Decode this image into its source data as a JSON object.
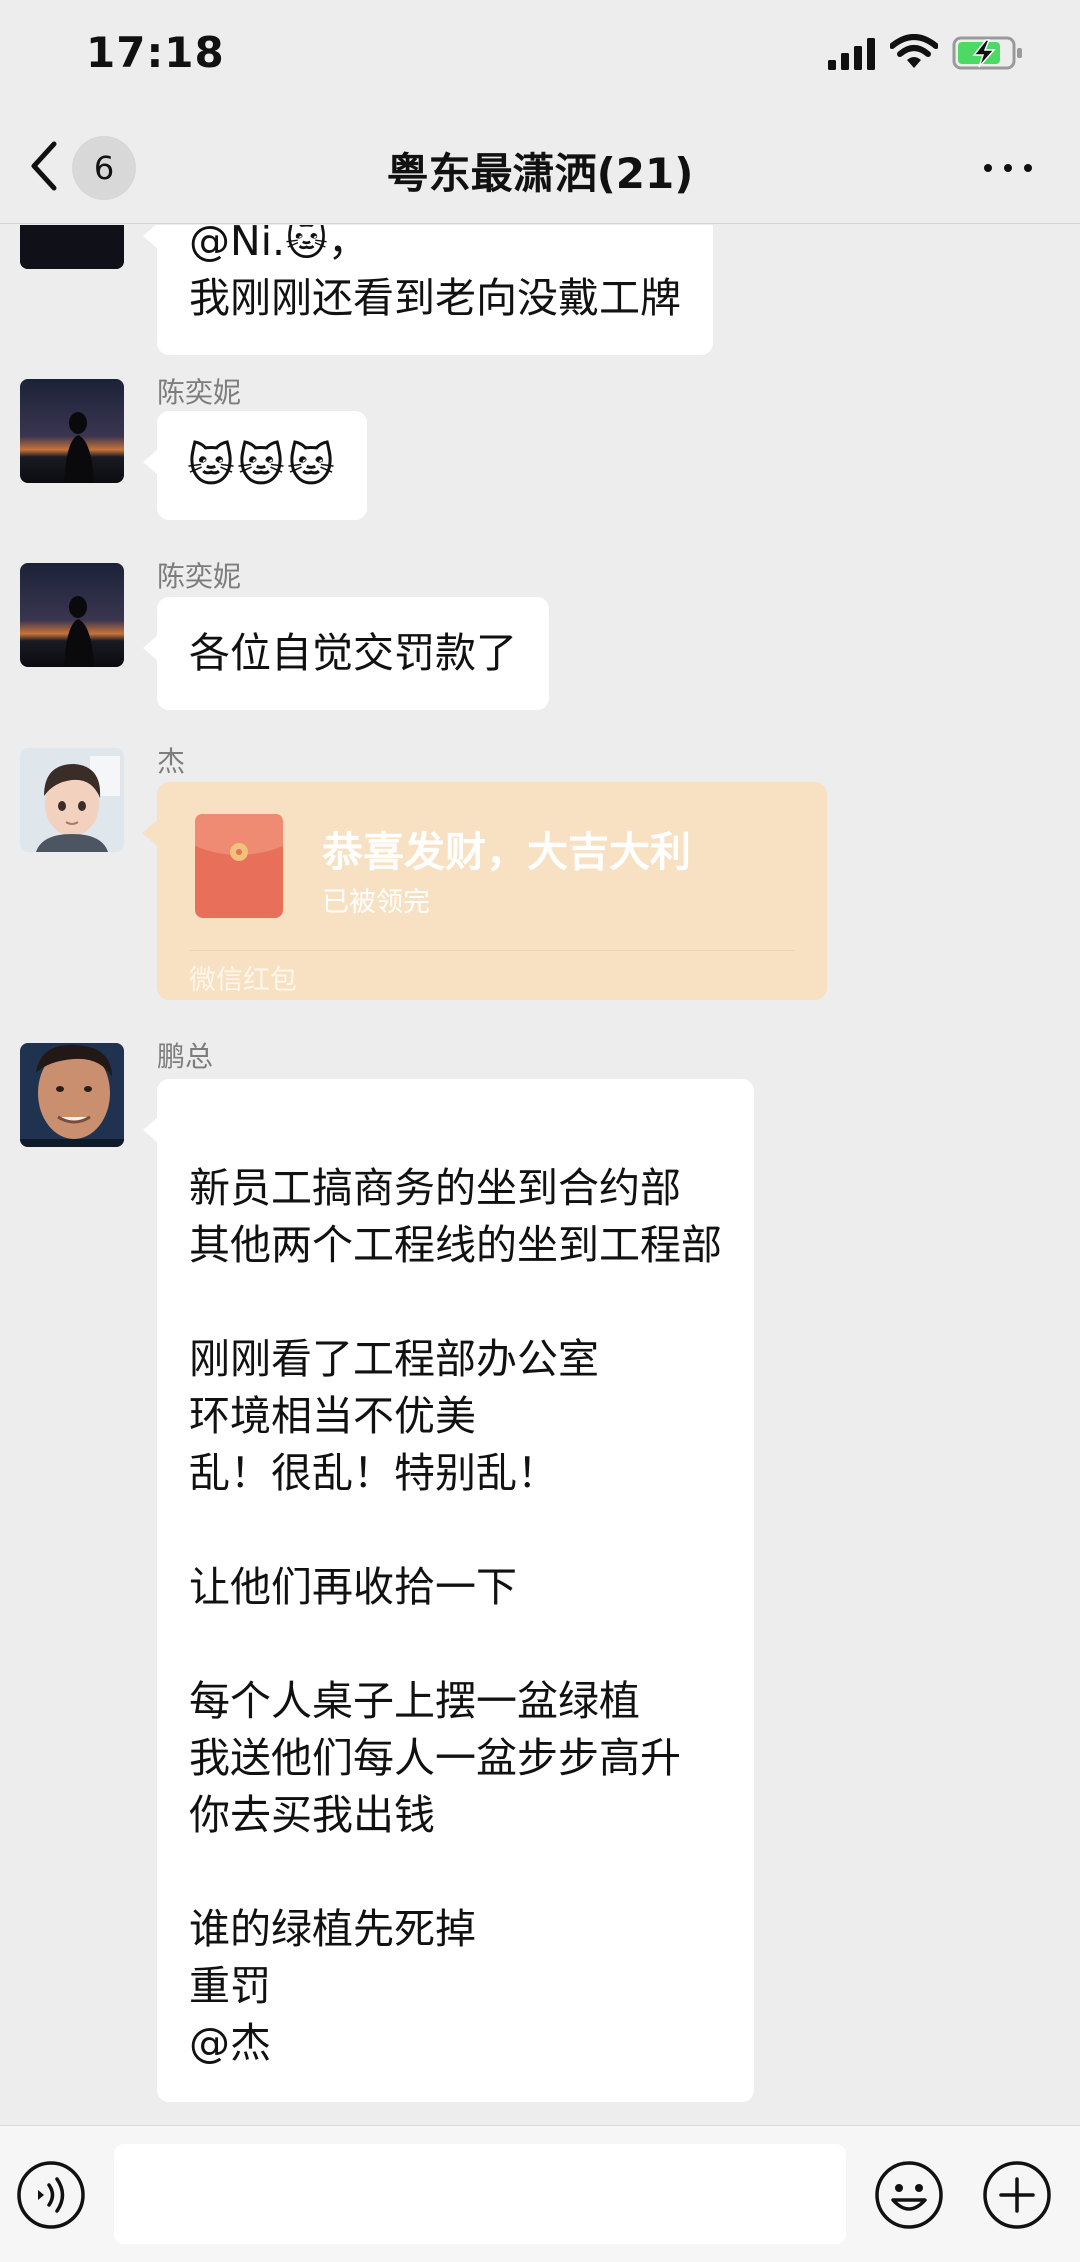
{
  "status_bar": {
    "time": "17:18",
    "icons": [
      "signal-icon",
      "wifi-icon",
      "battery-charging-icon"
    ]
  },
  "nav": {
    "unread_count": "6",
    "title": "粤东最潇洒(21)"
  },
  "messages": [
    {
      "sender": "",
      "type": "text",
      "partially_visible": true,
      "lines": [
        "@Ni.🐱，",
        "我刚刚还看到老向没戴工牌"
      ]
    },
    {
      "sender": "陈奕妮",
      "type": "emoji",
      "emojis": [
        "🐱",
        "🐱",
        "🐱"
      ]
    },
    {
      "sender": "陈奕妮",
      "type": "text",
      "lines": [
        "各位自觉交罚款了"
      ]
    },
    {
      "sender": "杰",
      "type": "red_packet",
      "greeting": "恭喜发财，大吉大利",
      "status": "已被领完",
      "label": "微信红包"
    },
    {
      "sender": "鹏总",
      "type": "text",
      "lines": [
        "",
        "新员工搞商务的坐到合约部",
        "其他两个工程线的坐到工程部",
        "",
        "刚刚看了工程部办公室",
        "环境相当不优美",
        "乱！很乱！特别乱！",
        "",
        "让他们再收拾一下",
        "",
        "每个人桌子上摆一盆绿植",
        "我送他们每人一盆步步高升",
        "你去买我出钱",
        "",
        "谁的绿植先死掉",
        "重罚",
        "@杰"
      ]
    }
  ],
  "input_bar": {
    "placeholder": ""
  },
  "colors": {
    "background": "#ededed",
    "bubble": "#ffffff",
    "red_packet": "#f8e1c3",
    "red_packet_icon": "#e8705a"
  }
}
